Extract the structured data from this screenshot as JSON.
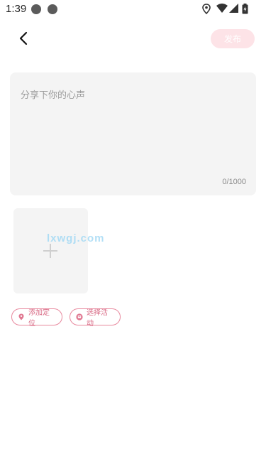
{
  "status_bar": {
    "time": "1:39",
    "notifications": [
      "notification-app-icon",
      "notification-app-icon"
    ],
    "icons": [
      "location-icon",
      "wifi-icon",
      "signal-icon",
      "battery-icon"
    ]
  },
  "header": {
    "back_icon": "chevron-left-icon",
    "publish_label": "发布"
  },
  "composer": {
    "placeholder": "分享下你的心声",
    "char_count": "0/1000"
  },
  "media": {
    "add_icon": "plus-icon"
  },
  "watermark": "lxwgj.com",
  "chips": {
    "location_label": "添加定位",
    "activity_label": "选择活动"
  },
  "colors": {
    "accent": "#e8889d",
    "publish_disabled_bg": "#fde3e7",
    "input_bg": "#f4f4f4"
  }
}
